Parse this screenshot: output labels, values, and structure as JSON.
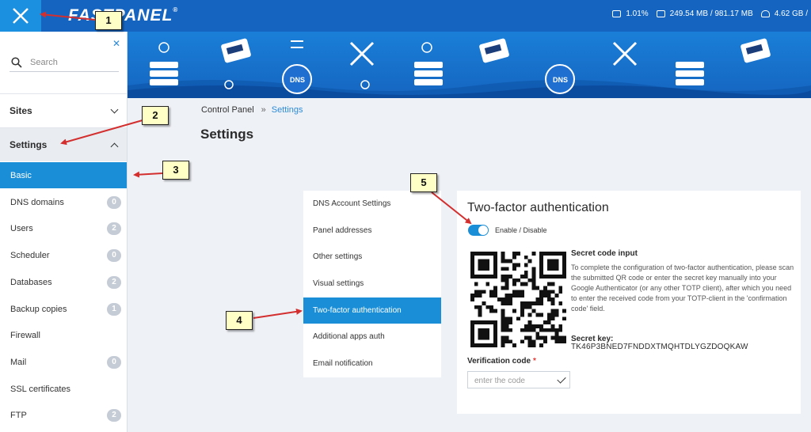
{
  "topbar": {
    "logo": "FASTPANEL",
    "logo_mark": "®",
    "cpu": "1.01%",
    "ram": "249.54 MB / 981.17 MB",
    "disk": "4.62 GB /"
  },
  "sidebar": {
    "search_placeholder": "Search",
    "sections": {
      "sites": "Sites",
      "settings": "Settings"
    },
    "items": [
      {
        "label": "Basic",
        "count": null
      },
      {
        "label": "DNS domains",
        "count": "0"
      },
      {
        "label": "Users",
        "count": "2"
      },
      {
        "label": "Scheduler",
        "count": "0"
      },
      {
        "label": "Databases",
        "count": "2"
      },
      {
        "label": "Backup copies",
        "count": "1"
      },
      {
        "label": "Firewall",
        "count": null
      },
      {
        "label": "Mail",
        "count": "0"
      },
      {
        "label": "SSL certificates",
        "count": null
      },
      {
        "label": "FTP",
        "count": "2"
      }
    ]
  },
  "breadcrumb": {
    "root": "Control Panel",
    "separator": "»",
    "current": "Settings"
  },
  "page_title": "Settings",
  "submenu": [
    "DNS Account Settings",
    "Panel addresses",
    "Other settings",
    "Visual settings",
    "Two-factor authentication",
    "Additional apps auth",
    "Email notification"
  ],
  "panel": {
    "title": "Two-factor authentication",
    "toggle_label": "Enable / Disable",
    "toggle_on": true,
    "secret_title": "Secret code input",
    "secret_text": "To complete the configuration of two-factor authentication, please scan the submitted QR code or enter the secret key manually into your Google Authenticator (or any other TOTP client), after which you need to enter the received code from your TOTP-client in the 'confirmation code' field.",
    "key_label": "Secret key:",
    "key_value": "TK46P3BNED7FNDDXTMQHTDLYGZDOQKAW",
    "verification_label": "Verification code",
    "required_mark": "*",
    "code_placeholder": "enter the code"
  },
  "callouts": [
    "1",
    "2",
    "3",
    "4",
    "5"
  ],
  "colors": {
    "topbar": "#1565c0",
    "accent": "#1a8fd8",
    "arrow": "#d32f2f",
    "callout_bg": "#ffffc6"
  }
}
